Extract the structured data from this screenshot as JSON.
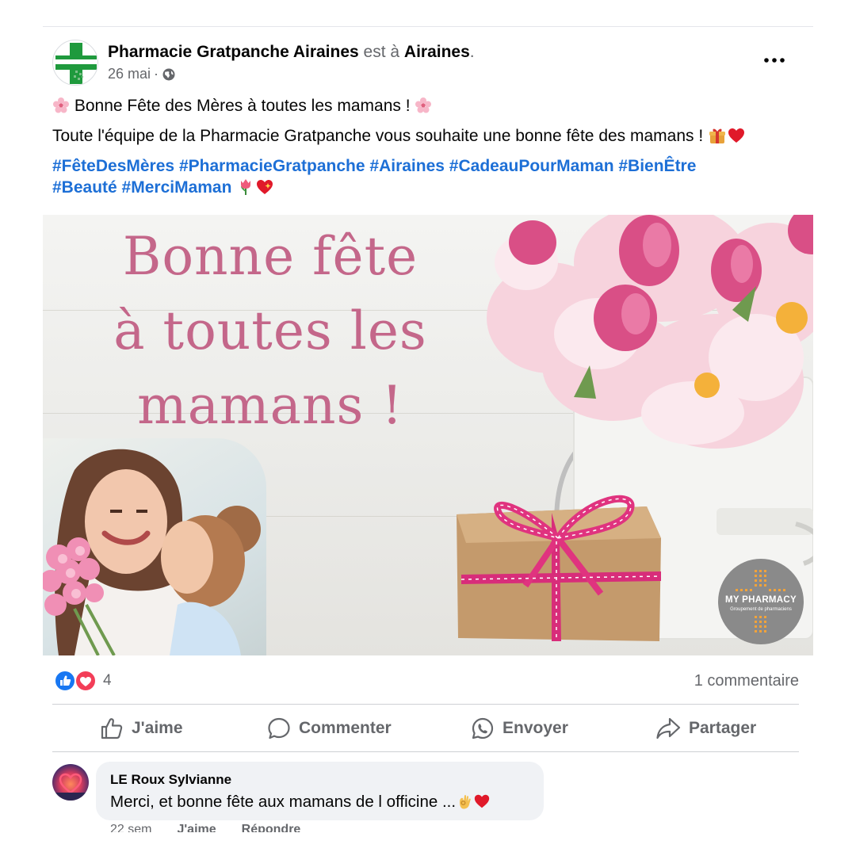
{
  "post": {
    "author_name": "Pharmacie Gratpanche Airaines",
    "checkin_text": "est à",
    "place_name": "Airaines",
    "period": ".",
    "date": "26 mai",
    "separator": "·",
    "privacy_icon": "globe-icon",
    "more_icon": "more-horizontal-icon",
    "avatar_text": "Pharmacie GRATPANCHE"
  },
  "text": {
    "line1": "Bonne Fête des Mères à toutes les mamans !",
    "line2": "Toute l'équipe de la Pharmacie Gratpanche vous souhaite une bonne fête des mamans !",
    "hashtags": [
      "#FêteDesMères",
      "#PharmacieGratpanche",
      "#Airaines",
      "#CadeauPourMaman",
      "#BienÊtre",
      "#Beauté",
      "#MerciMaman"
    ]
  },
  "image": {
    "greeting_line1": "Bonne fête",
    "greeting_line2": "à toutes les",
    "greeting_line3": "mamans !",
    "badge_title": "MY PHARMACY",
    "badge_subtitle": "Groupement de pharmaciens"
  },
  "reactions": {
    "count": "4",
    "comments": "1 commentaire"
  },
  "actions": {
    "like": "J'aime",
    "comment": "Commenter",
    "send": "Envoyer",
    "share": "Partager"
  },
  "comment": {
    "author": "LE Roux Sylvianne",
    "text": "Merci, et bonne fête aux mamans de l officine ...",
    "time": "22 sem",
    "like": "J'aime",
    "reply": "Répondre"
  },
  "colors": {
    "hashtag": "#1d6fd6",
    "like_blue": "#1877f2",
    "love_red": "#f33e58",
    "greeting_pink": "#c4678a",
    "muted": "#65676b"
  }
}
